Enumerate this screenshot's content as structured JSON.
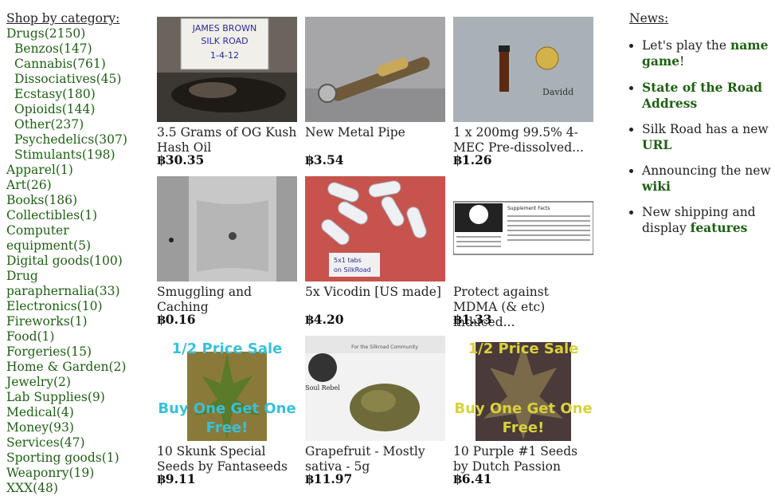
{
  "sidebar": {
    "heading": "Shop by category:",
    "categories": [
      {
        "label": "Drugs(2150)",
        "sub": false
      },
      {
        "label": "Benzos(147)",
        "sub": true
      },
      {
        "label": "Cannabis(761)",
        "sub": true
      },
      {
        "label": "Dissociatives(45)",
        "sub": true
      },
      {
        "label": "Ecstasy(180)",
        "sub": true
      },
      {
        "label": "Opioids(144)",
        "sub": true
      },
      {
        "label": "Other(237)",
        "sub": true
      },
      {
        "label": "Psychedelics(307)",
        "sub": true
      },
      {
        "label": "Stimulants(198)",
        "sub": true
      },
      {
        "label": "Apparel(1)",
        "sub": false
      },
      {
        "label": "Art(26)",
        "sub": false
      },
      {
        "label": "Books(186)",
        "sub": false
      },
      {
        "label": "Collectibles(1)",
        "sub": false
      },
      {
        "label": "Computer equipment(5)",
        "sub": false
      },
      {
        "label": "Digital goods(100)",
        "sub": false
      },
      {
        "label": "Drug paraphernalia(33)",
        "sub": false
      },
      {
        "label": "Electronics(10)",
        "sub": false
      },
      {
        "label": "Fireworks(1)",
        "sub": false
      },
      {
        "label": "Food(1)",
        "sub": false
      },
      {
        "label": "Forgeries(15)",
        "sub": false
      },
      {
        "label": "Home & Garden(2)",
        "sub": false
      },
      {
        "label": "Jewelry(2)",
        "sub": false
      },
      {
        "label": "Lab Supplies(9)",
        "sub": false
      },
      {
        "label": "Medical(4)",
        "sub": false
      },
      {
        "label": "Money(93)",
        "sub": false
      },
      {
        "label": "Services(47)",
        "sub": false
      },
      {
        "label": "Sporting goods(1)",
        "sub": false
      },
      {
        "label": "Weaponry(19)",
        "sub": false
      },
      {
        "label": "XXX(48)",
        "sub": false
      }
    ]
  },
  "listings": [
    {
      "title": "3.5 Grams of OG Kush Hash Oil",
      "price": "฿30.35",
      "image_text": "JAMES BROWN SILK ROAD 1-4-12"
    },
    {
      "title": "New Metal Pipe",
      "price": "฿3.54",
      "image_text": ""
    },
    {
      "title": "1 x 200mg 99.5% 4-MEC Pre-dissolved...",
      "price": "฿1.26",
      "image_text": "Davidd"
    },
    {
      "title": "Smuggling and Caching",
      "price": "฿0.16",
      "image_text": ""
    },
    {
      "title": "5x Vicodin [US made]",
      "price": "฿4.20",
      "image_text": "5x1 tabs on SilkRoad"
    },
    {
      "title": "Protect against MDMA (& etc) induced...",
      "price": "฿1.33",
      "image_text": "Supplement Facts"
    },
    {
      "title": "10 Skunk Special Seeds by Fantaseeds",
      "price": "฿9.11",
      "image_text": "1/2 Price Sale",
      "image_text2": "Buy One Get One Free!"
    },
    {
      "title": "Grapefruit - Mostly sativa - 5g",
      "price": "฿11.97",
      "image_text": "Soul Rebel",
      "image_text2": "For the Silkroad Community"
    },
    {
      "title": "10 Purple #1 Seeds by Dutch Passion",
      "price": "฿6.41",
      "image_text": "1/2 Price Sale",
      "image_text2": "Buy One Get One Free!"
    }
  ],
  "news": {
    "heading": "News:",
    "items": [
      {
        "text": "Let's play the",
        "link": "name game",
        "after": "!"
      },
      {
        "text": "",
        "link": "State of the Road Address",
        "after": ""
      },
      {
        "text": "Silk Road has a new",
        "link": "URL",
        "after": ""
      },
      {
        "text": "Announcing the new",
        "link": "wiki",
        "after": ""
      },
      {
        "text": "New shipping and display",
        "link": "features",
        "after": ""
      }
    ]
  }
}
